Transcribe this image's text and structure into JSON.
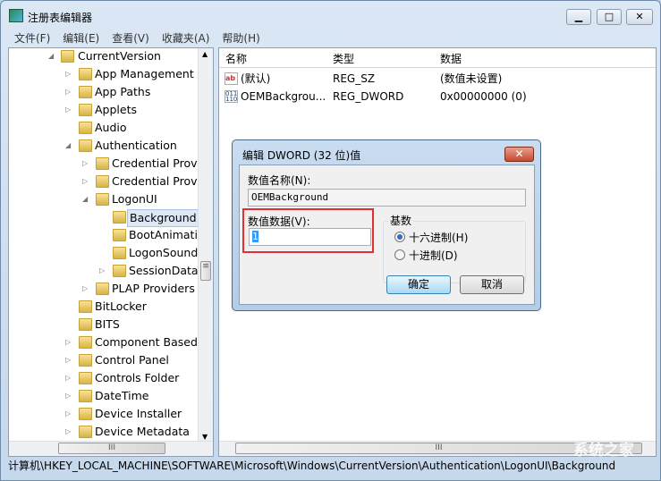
{
  "window": {
    "title": "注册表编辑器",
    "icon": "regedit-icon"
  },
  "menu": [
    "文件(F)",
    "编辑(E)",
    "查看(V)",
    "收藏夹(A)",
    "帮助(H)"
  ],
  "tree": [
    {
      "label": "CurrentVersion",
      "level": 0,
      "expanded": true
    },
    {
      "label": "App Management",
      "level": 1
    },
    {
      "label": "App Paths",
      "level": 1
    },
    {
      "label": "Applets",
      "level": 1
    },
    {
      "label": "Audio",
      "level": 1,
      "leaf": true
    },
    {
      "label": "Authentication",
      "level": 1,
      "expanded": true
    },
    {
      "label": "Credential Provid",
      "level": 2
    },
    {
      "label": "Credential Provid",
      "level": 2
    },
    {
      "label": "LogonUI",
      "level": 2,
      "expanded": true
    },
    {
      "label": "Background",
      "level": 3,
      "selected": true,
      "leaf": true
    },
    {
      "label": "BootAnimatio",
      "level": 3,
      "leaf": true
    },
    {
      "label": "LogonSoundP",
      "level": 3,
      "leaf": true
    },
    {
      "label": "SessionData",
      "level": 3
    },
    {
      "label": "PLAP Providers",
      "level": 2
    },
    {
      "label": "BitLocker",
      "level": 1,
      "leaf": true
    },
    {
      "label": "BITS",
      "level": 1,
      "leaf": true
    },
    {
      "label": "Component Based S",
      "level": 1
    },
    {
      "label": "Control Panel",
      "level": 1
    },
    {
      "label": "Controls Folder",
      "level": 1
    },
    {
      "label": "DateTime",
      "level": 1
    },
    {
      "label": "Device Installer",
      "level": 1
    },
    {
      "label": "Device Metadata",
      "level": 1
    }
  ],
  "list": {
    "columns": [
      "名称",
      "类型",
      "数据"
    ],
    "rows": [
      {
        "name": "(默认)",
        "type": "REG_SZ",
        "data": "(数值未设置)",
        "icon": "string-value-icon"
      },
      {
        "name": "OEMBackgrou...",
        "type": "REG_DWORD",
        "data": "0x00000000 (0)",
        "icon": "binary-value-icon"
      }
    ]
  },
  "status": "计算机\\HKEY_LOCAL_MACHINE\\SOFTWARE\\Microsoft\\Windows\\CurrentVersion\\Authentication\\LogonUI\\Background",
  "watermark": "系统之家",
  "dialog": {
    "title": "编辑 DWORD (32 位)值",
    "name_label": "数值名称(N):",
    "name_value": "OEMBackground",
    "data_label": "数值数据(V):",
    "data_value": "1",
    "base_label": "基数",
    "hex_label": "十六进制(H)",
    "dec_label": "十进制(D)",
    "selected_base": "hex",
    "ok": "确定",
    "cancel": "取消",
    "highlight_color": "#e03030"
  }
}
